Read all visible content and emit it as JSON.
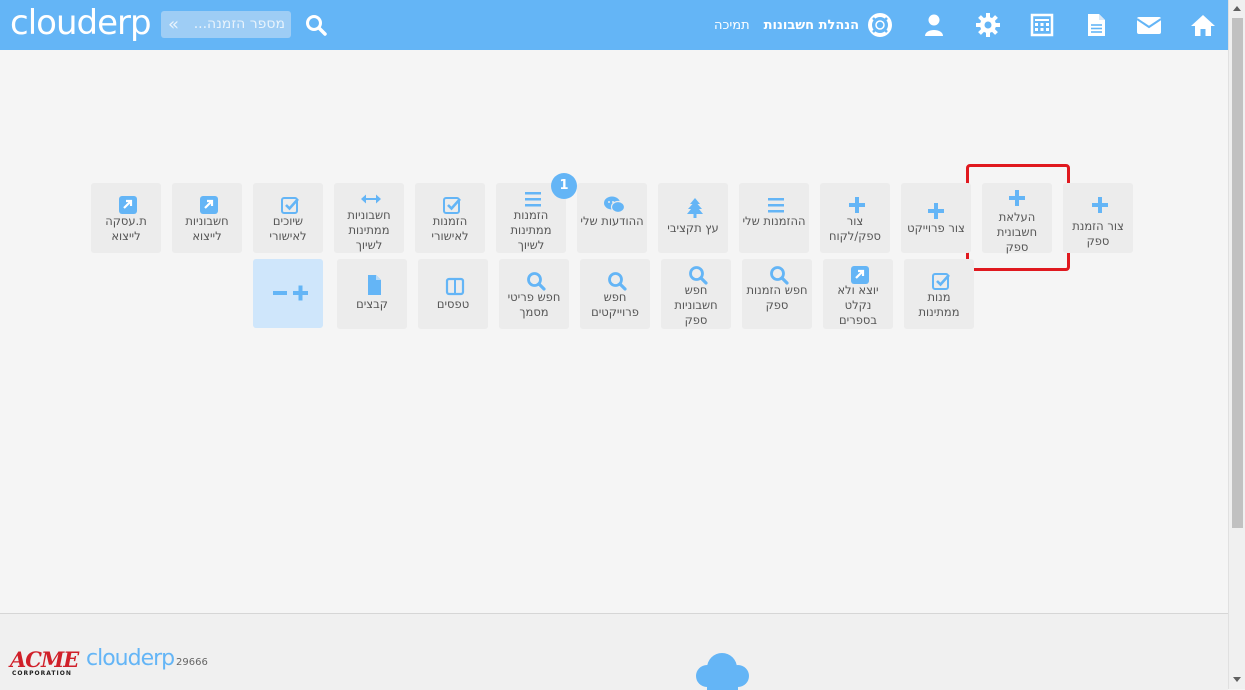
{
  "app": {
    "logo": "clouderp",
    "search_placeholder": "מספר הזמנה...",
    "nav": {
      "accounting": "הנהלת חשבונות",
      "support": "תמיכה"
    }
  },
  "top_icons": [
    "home-icon",
    "mail-icon",
    "document-icon",
    "calculator-icon",
    "gear-icon",
    "user-icon",
    "lifebuoy-icon"
  ],
  "tiles_row1": [
    {
      "label": "צור הזמנת ספק",
      "icon": "plus-icon"
    },
    {
      "label": "העלאת חשבונית ספק",
      "icon": "plus-icon"
    },
    {
      "label": "צור פרוייקט",
      "icon": "plus-icon"
    },
    {
      "label": "צור ספק/לקוח",
      "icon": "plus-icon"
    },
    {
      "label": "ההזמנות שלי",
      "icon": "list-icon"
    },
    {
      "label": "עץ תקציבי",
      "icon": "tree-icon"
    },
    {
      "label": "ההודעות שלי",
      "icon": "chat-icon"
    },
    {
      "label": "הזמנות ממתינות לשיוך",
      "icon": "list-icon"
    },
    {
      "label": "הזמנות לאישורי",
      "icon": "check-icon"
    },
    {
      "label": "חשבוניות ממתינות לשיוך",
      "icon": "arrows-icon"
    },
    {
      "label": "שיוכים לאישורי",
      "icon": "check-icon"
    },
    {
      "label": "חשבוניות לייצוא",
      "icon": "export-icon"
    },
    {
      "label": "ת.עסקה לייצוא",
      "icon": "export-icon"
    }
  ],
  "tiles_row2": [
    {
      "label": "מנות ממתינות",
      "icon": "check-icon"
    },
    {
      "label": "יוצא ולא נקלט בספרים",
      "icon": "export-icon"
    },
    {
      "label": "חפש הזמנות ספק",
      "icon": "search-icon"
    },
    {
      "label": "חפש חשבוניות ספק",
      "icon": "search-icon"
    },
    {
      "label": "חפש פרוייקטים",
      "icon": "search-icon"
    },
    {
      "label": "חפש פריטי מסמך",
      "icon": "search-icon"
    },
    {
      "label": "טפסים",
      "icon": "columns-icon"
    },
    {
      "label": "קבצים",
      "icon": "file-icon"
    }
  ],
  "badge_count": "1",
  "footer": {
    "company": "ACME",
    "company_sub": "CORPORATION",
    "logo": "clouderp",
    "version": "29666"
  },
  "colors": {
    "primary": "#64b5f6",
    "tile_bg": "#ececec",
    "highlight": "#e0191f"
  }
}
